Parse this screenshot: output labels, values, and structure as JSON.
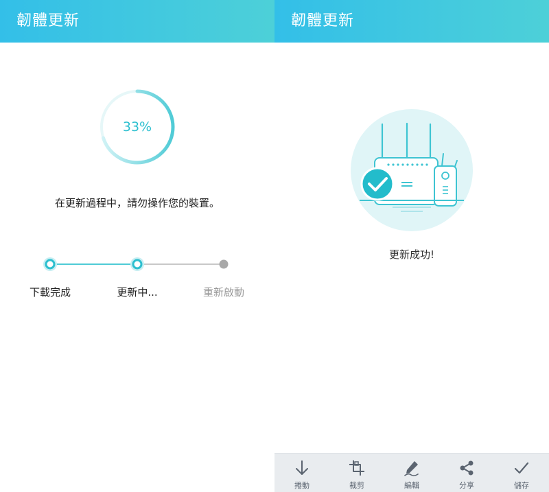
{
  "left_screen": {
    "header_title": "韌體更新",
    "progress_percent_text": "33%",
    "progress_fraction": 0.33,
    "notice": "在更新過程中，請勿操作您的裝置。",
    "steps": [
      {
        "label": "下載完成",
        "state": "done"
      },
      {
        "label": "更新中...",
        "state": "active"
      },
      {
        "label": "重新啟動",
        "state": "pending"
      }
    ]
  },
  "right_screen": {
    "header_title": "韌體更新",
    "success_message": "更新成功!"
  },
  "toolbar": {
    "items": [
      {
        "label": "捲動",
        "icon": "arrow-down-icon"
      },
      {
        "label": "裁剪",
        "icon": "crop-icon"
      },
      {
        "label": "編輯",
        "icon": "pen-icon"
      },
      {
        "label": "分享",
        "icon": "share-icon"
      },
      {
        "label": "儲存",
        "icon": "check-icon"
      }
    ]
  },
  "colors": {
    "header_start": "#33bfe8",
    "header_end": "#4dd0d8",
    "accent": "#2cbfcf",
    "pending_gray": "#a8a8a8",
    "toolbar_bg": "#e9ecef"
  }
}
